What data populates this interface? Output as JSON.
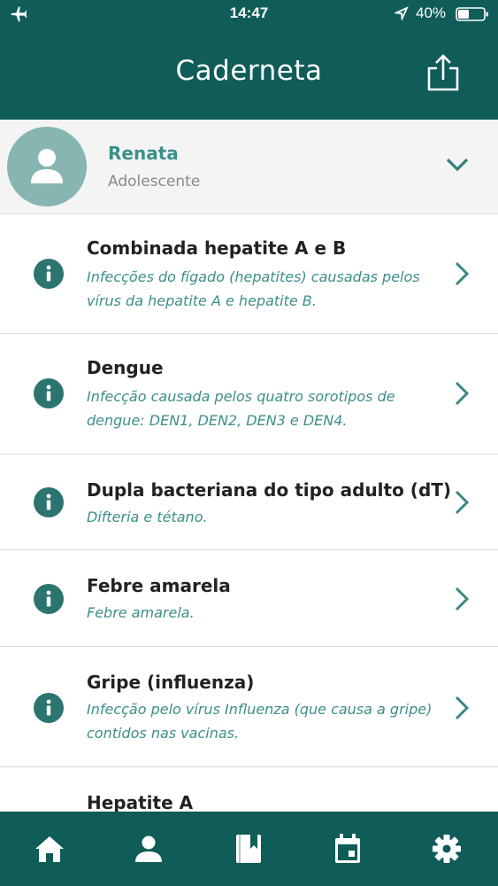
{
  "status": {
    "time": "14:47",
    "battery": "40%"
  },
  "header": {
    "title": "Caderneta"
  },
  "profile": {
    "name": "Renata",
    "category": "Adolescente"
  },
  "vaccines": [
    {
      "title": "Combinada hepatite A e B",
      "description": "Infecções do fígado (hepatites) causadas pelos vírus da hepatite A e hepatite B."
    },
    {
      "title": "Dengue",
      "description": "Infecção causada pelos quatro sorotipos de dengue: DEN1, DEN2, DEN3 e DEN4."
    },
    {
      "title": "Dupla bacteriana do tipo adulto (dT)",
      "description": "Difteria e tétano."
    },
    {
      "title": "Febre amarela",
      "description": "Febre amarela."
    },
    {
      "title": "Gripe (influenza)",
      "description": "Infecção pelo vírus Influenza (que causa a gripe) contidos nas vacinas."
    },
    {
      "title": "Hepatite A",
      "description": ""
    }
  ],
  "tabs": [
    "home-icon",
    "person-icon",
    "book-icon",
    "calendar-icon",
    "gear-icon"
  ],
  "colors": {
    "primary": "#0f5c58",
    "accent": "#3b8f89",
    "avatar": "#86b5b2"
  }
}
